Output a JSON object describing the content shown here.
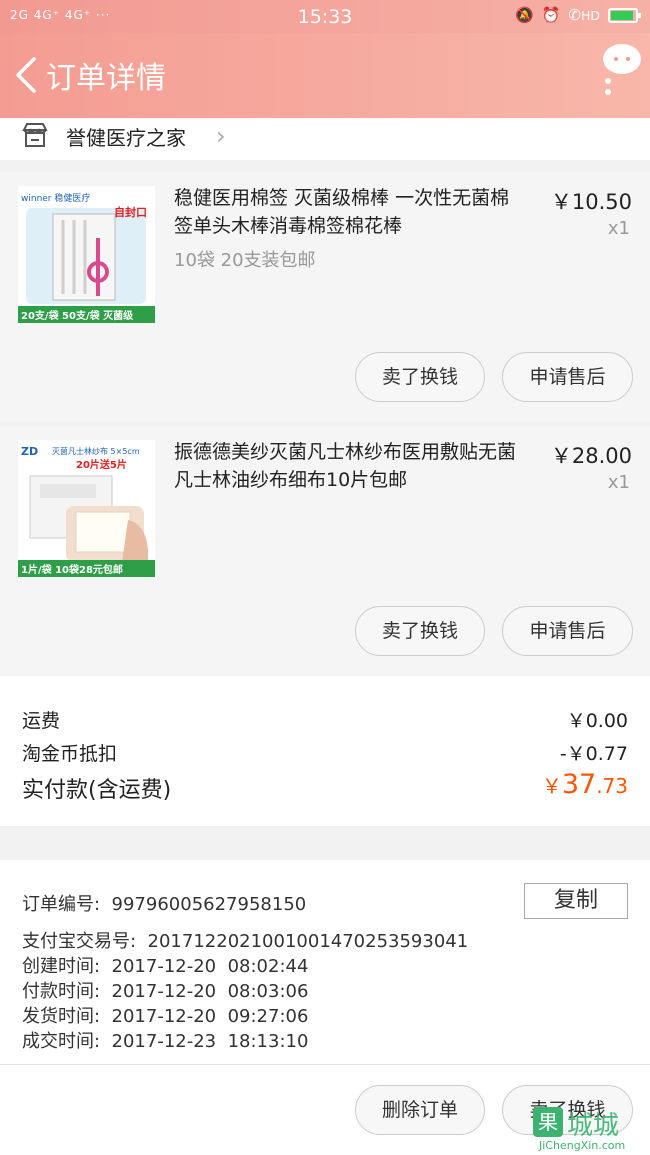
{
  "status_bar": {
    "signal": "2G 4G⁺ 4G⁺ ···",
    "time": "15:33",
    "hd": "HD"
  },
  "header": {
    "title": "订单详情",
    "back_icon": "chevron-left-icon",
    "menu_icon": "chat-bubble-icon"
  },
  "shop": {
    "name": "誉健医疗之家",
    "icon": "store-icon"
  },
  "items": [
    {
      "title": "稳健医用棉签 灭菌级棉棒 一次性无菌棉签单头木棒消毒棉签棉花棒",
      "sku": "10袋 20支装包邮",
      "price": "￥10.50",
      "qty": "x1",
      "thumb_brand": "winner 稳健医疗",
      "thumb_tag": "自封口",
      "thumb_caption": "20支/袋 50支/袋 灭菌级",
      "actions": {
        "sell": "卖了换钱",
        "after_sale": "申请售后"
      }
    },
    {
      "title": "振德德美纱灭菌凡士林纱布医用敷贴无菌凡士林油纱布细布10片包邮",
      "sku": "",
      "price": "￥28.00",
      "qty": "x1",
      "thumb_brand": "ZD",
      "thumb_header": "灭菌凡士林纱布 5×5cm",
      "thumb_tag": "20片送5片",
      "thumb_caption": "1片/袋 10袋28元包邮",
      "actions": {
        "sell": "卖了换钱",
        "after_sale": "申请售后"
      }
    }
  ],
  "summary": {
    "shipping_label": "运费",
    "shipping_value": "￥0.00",
    "coin_label": "淘金币抵扣",
    "coin_value": "-￥0.77",
    "total_label": "实付款(含运费)",
    "total_currency": "￥",
    "total_integer": "37",
    "total_decimal": ".73"
  },
  "order_info": {
    "order_no_label": "订单编号:",
    "order_no": "99796005627958150",
    "copy_label": "复制",
    "alipay_label": "支付宝交易号:",
    "alipay_no": "2017122021001001470253593041",
    "created_label": "创建时间:",
    "created": "2017-12-20  08:02:44",
    "paid_label": "付款时间:",
    "paid": "2017-12-20  08:03:06",
    "shipped_label": "发货时间:",
    "shipped": "2017-12-20  09:27:06",
    "completed_label": "成交时间:",
    "completed": "2017-12-23  18:13:10"
  },
  "footer": {
    "delete_label": "删除订单",
    "sell_label": "卖了换钱"
  },
  "watermark": {
    "logo": "果",
    "text": "城城",
    "url": "JiChengXin.com"
  },
  "colors": {
    "header_gradient_start": "#f49c92",
    "header_gradient_end": "#f8b7aa",
    "total_accent": "#ff5500",
    "battery_fill": "#33cc55"
  }
}
